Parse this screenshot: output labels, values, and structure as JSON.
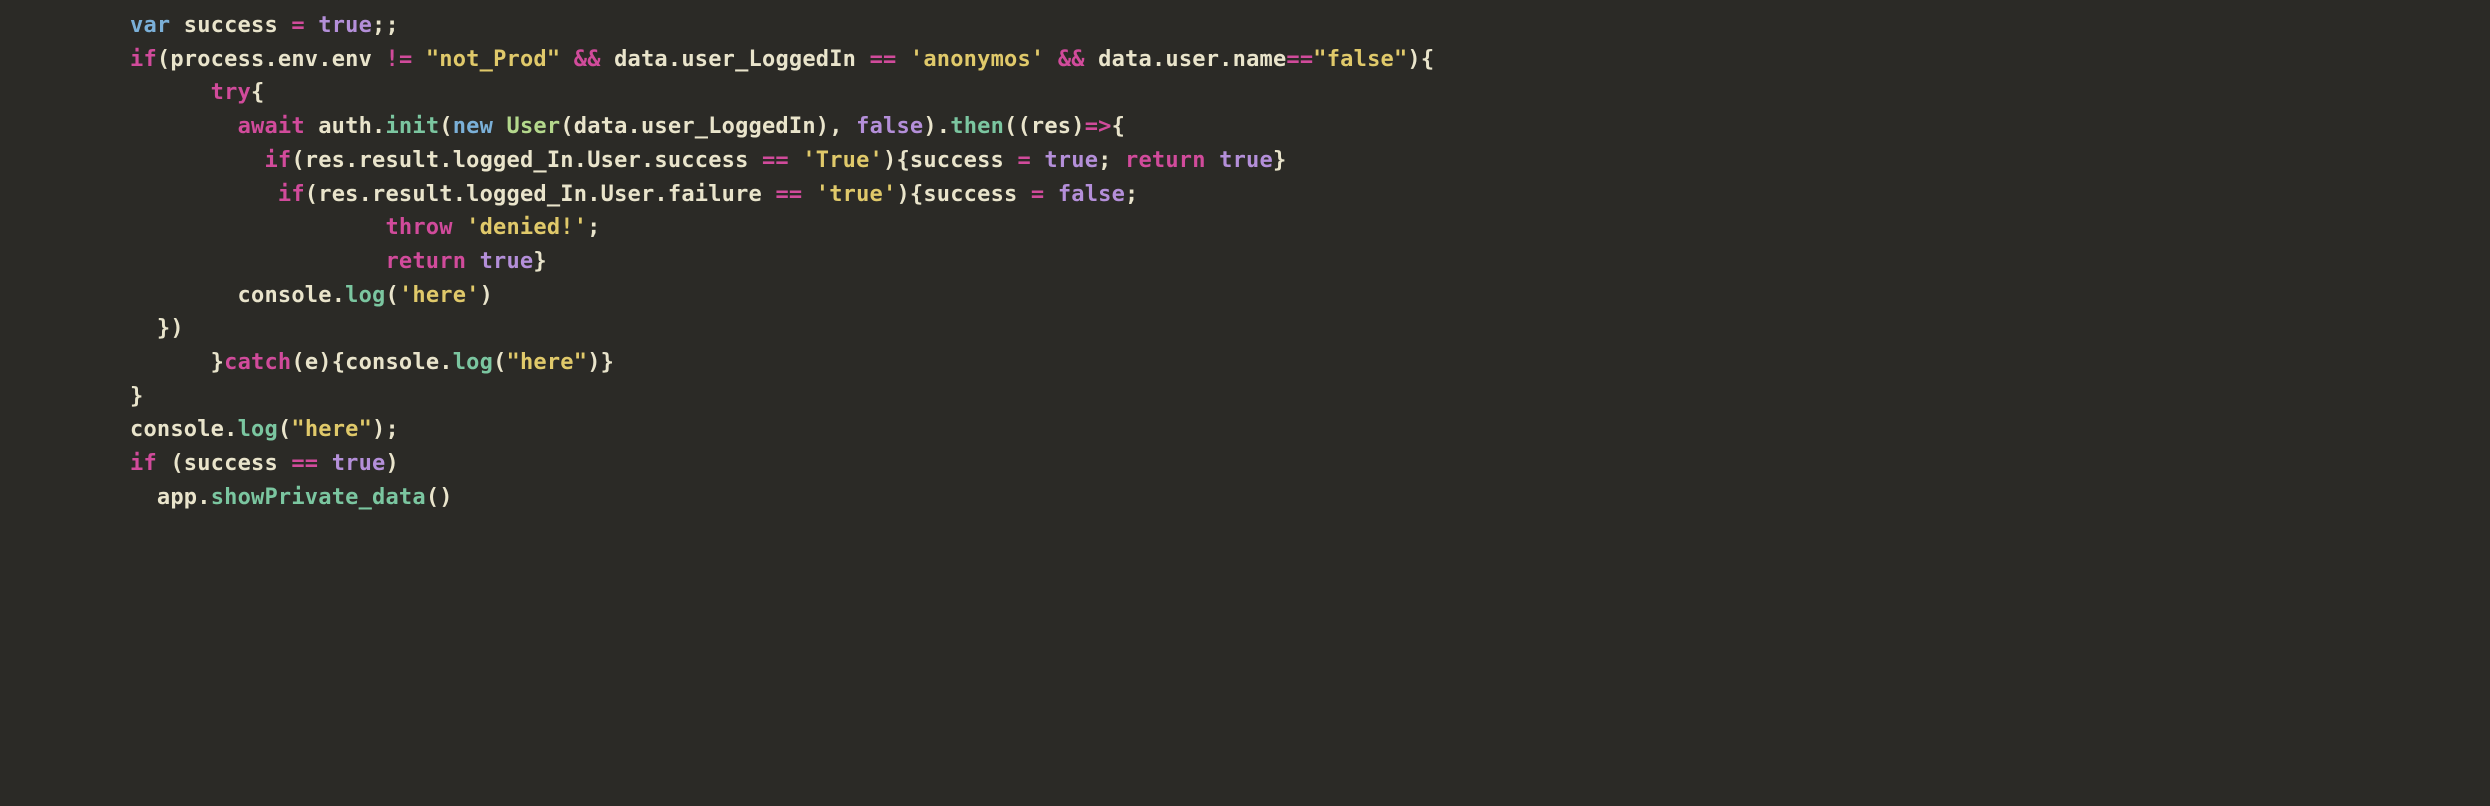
{
  "code": {
    "tokens": [
      [
        [
          "k-var",
          "var "
        ],
        [
          "k-id",
          "success "
        ],
        [
          "k-op",
          "="
        ],
        [
          "k-id",
          " "
        ],
        [
          "k-bool",
          "true"
        ],
        [
          "k-punc",
          ";;"
        ]
      ],
      [
        [
          "k-if",
          "if"
        ],
        [
          "k-punc",
          "("
        ],
        [
          "k-id",
          "process"
        ],
        [
          "k-punc",
          "."
        ],
        [
          "k-id",
          "env"
        ],
        [
          "k-punc",
          "."
        ],
        [
          "k-id",
          "env "
        ],
        [
          "k-op",
          "!="
        ],
        [
          "k-id",
          " "
        ],
        [
          "k-str",
          "\"not_Prod\""
        ],
        [
          "k-id",
          " "
        ],
        [
          "k-op",
          "&&"
        ],
        [
          "k-id",
          " data"
        ],
        [
          "k-punc",
          "."
        ],
        [
          "k-id",
          "user_LoggedIn "
        ],
        [
          "k-op",
          "=="
        ],
        [
          "k-id",
          " "
        ],
        [
          "k-str",
          "'anonymos'"
        ],
        [
          "k-id",
          " "
        ],
        [
          "k-op",
          "&&"
        ],
        [
          "k-id",
          " data"
        ],
        [
          "k-punc",
          "."
        ],
        [
          "k-id",
          "user"
        ],
        [
          "k-punc",
          "."
        ],
        [
          "k-id",
          "name"
        ],
        [
          "k-op",
          "=="
        ],
        [
          "k-str",
          "\"false\""
        ],
        [
          "k-punc",
          "){"
        ]
      ],
      [
        [
          "k-id",
          "      "
        ],
        [
          "k-if",
          "try"
        ],
        [
          "k-punc",
          "{"
        ]
      ],
      [
        [
          "k-id",
          "        "
        ],
        [
          "k-if",
          "await"
        ],
        [
          "k-id",
          " auth"
        ],
        [
          "k-punc",
          "."
        ],
        [
          "fn",
          "init"
        ],
        [
          "k-punc",
          "("
        ],
        [
          "k-new",
          "new"
        ],
        [
          "k-id",
          " "
        ],
        [
          "k-type",
          "User"
        ],
        [
          "k-punc",
          "("
        ],
        [
          "k-id",
          "data"
        ],
        [
          "k-punc",
          "."
        ],
        [
          "k-id",
          "user_LoggedIn"
        ],
        [
          "k-punc",
          "), "
        ],
        [
          "k-bool",
          "false"
        ],
        [
          "k-punc",
          ")."
        ],
        [
          "fn",
          "then"
        ],
        [
          "k-punc",
          "(("
        ],
        [
          "k-id",
          "res"
        ],
        [
          "k-punc",
          ")"
        ],
        [
          "k-op",
          "=>"
        ],
        [
          "k-punc",
          "{"
        ]
      ],
      [
        [
          "k-id",
          "          "
        ],
        [
          "k-if",
          "if"
        ],
        [
          "k-punc",
          "("
        ],
        [
          "k-id",
          "res"
        ],
        [
          "k-punc",
          "."
        ],
        [
          "k-id",
          "result"
        ],
        [
          "k-punc",
          "."
        ],
        [
          "k-id",
          "logged_In"
        ],
        [
          "k-punc",
          "."
        ],
        [
          "k-id",
          "User"
        ],
        [
          "k-punc",
          "."
        ],
        [
          "k-id",
          "success "
        ],
        [
          "k-op",
          "=="
        ],
        [
          "k-id",
          " "
        ],
        [
          "k-str",
          "'True'"
        ],
        [
          "k-punc",
          "){"
        ],
        [
          "k-id",
          "success "
        ],
        [
          "k-op",
          "="
        ],
        [
          "k-id",
          " "
        ],
        [
          "k-bool",
          "true"
        ],
        [
          "k-punc",
          "; "
        ],
        [
          "k-if",
          "return"
        ],
        [
          "k-id",
          " "
        ],
        [
          "k-bool",
          "true"
        ],
        [
          "k-punc",
          "}"
        ]
      ],
      [
        [
          "k-id",
          "           "
        ],
        [
          "k-if",
          "if"
        ],
        [
          "k-punc",
          "("
        ],
        [
          "k-id",
          "res"
        ],
        [
          "k-punc",
          "."
        ],
        [
          "k-id",
          "result"
        ],
        [
          "k-punc",
          "."
        ],
        [
          "k-id",
          "logged_In"
        ],
        [
          "k-punc",
          "."
        ],
        [
          "k-id",
          "User"
        ],
        [
          "k-punc",
          "."
        ],
        [
          "k-id",
          "failure "
        ],
        [
          "k-op",
          "=="
        ],
        [
          "k-id",
          " "
        ],
        [
          "k-str",
          "'true'"
        ],
        [
          "k-punc",
          "){"
        ],
        [
          "k-id",
          "success "
        ],
        [
          "k-op",
          "="
        ],
        [
          "k-id",
          " "
        ],
        [
          "k-bool",
          "false"
        ],
        [
          "k-punc",
          ";"
        ]
      ],
      [
        [
          "k-id",
          "                   "
        ],
        [
          "k-if",
          "throw"
        ],
        [
          "k-id",
          " "
        ],
        [
          "k-str",
          "'denied!'"
        ],
        [
          "k-punc",
          ";"
        ]
      ],
      [
        [
          "k-id",
          "                   "
        ],
        [
          "k-if",
          "return"
        ],
        [
          "k-id",
          " "
        ],
        [
          "k-bool",
          "true"
        ],
        [
          "k-punc",
          "}"
        ]
      ],
      [
        [
          "k-id",
          "        console"
        ],
        [
          "k-punc",
          "."
        ],
        [
          "fn",
          "log"
        ],
        [
          "k-punc",
          "("
        ],
        [
          "k-str",
          "'here'"
        ],
        [
          "k-punc",
          ")"
        ]
      ],
      [
        [
          "k-punc",
          "  })"
        ]
      ],
      [
        [
          "k-id",
          "      "
        ],
        [
          "k-punc",
          "}"
        ],
        [
          "k-if",
          "catch"
        ],
        [
          "k-punc",
          "("
        ],
        [
          "k-id",
          "e"
        ],
        [
          "k-punc",
          "){"
        ],
        [
          "k-id",
          "console"
        ],
        [
          "k-punc",
          "."
        ],
        [
          "fn",
          "log"
        ],
        [
          "k-punc",
          "("
        ],
        [
          "k-str",
          "\"here\""
        ],
        [
          "k-punc",
          ")}"
        ]
      ],
      [
        [
          "k-punc",
          "}"
        ]
      ],
      [
        [
          "k-id",
          "console"
        ],
        [
          "k-punc",
          "."
        ],
        [
          "fn",
          "log"
        ],
        [
          "k-punc",
          "("
        ],
        [
          "k-str",
          "\"here\""
        ],
        [
          "k-punc",
          ");"
        ]
      ],
      [
        [
          "k-if",
          "if"
        ],
        [
          "k-id",
          " "
        ],
        [
          "k-punc",
          "("
        ],
        [
          "k-id",
          "success "
        ],
        [
          "k-op",
          "=="
        ],
        [
          "k-id",
          " "
        ],
        [
          "k-bool",
          "true"
        ],
        [
          "k-punc",
          ")"
        ]
      ],
      [
        [
          "k-id",
          "  app"
        ],
        [
          "k-punc",
          "."
        ],
        [
          "fn",
          "showPrivate_data"
        ],
        [
          "k-punc",
          "()"
        ]
      ]
    ]
  }
}
